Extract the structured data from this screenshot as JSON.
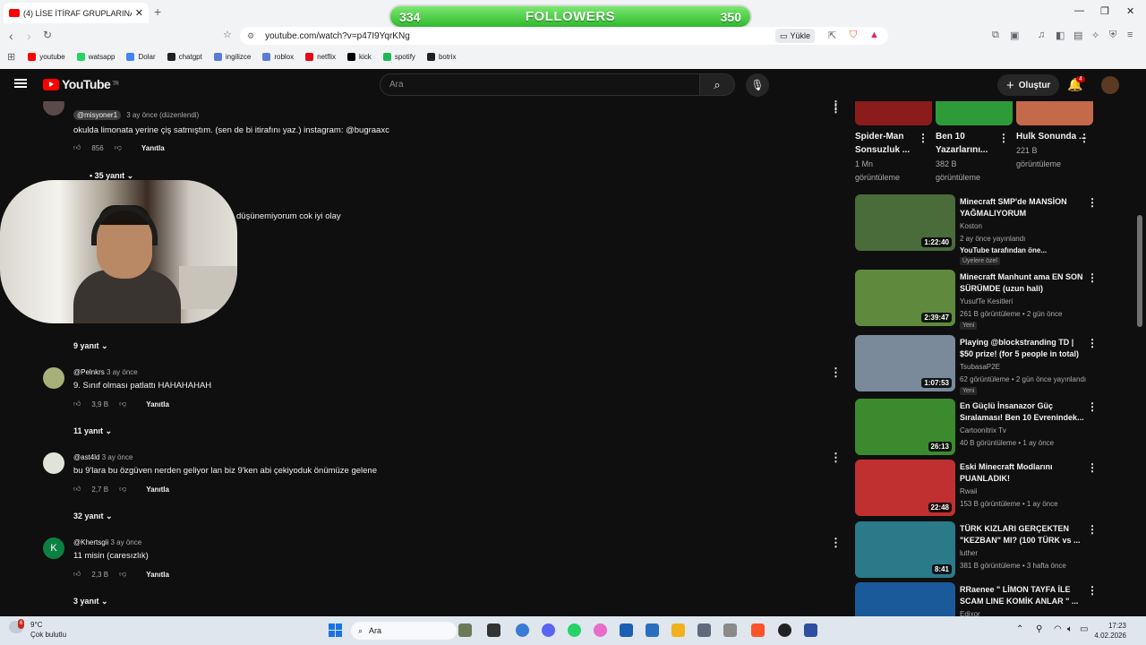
{
  "browser": {
    "tab_title": "(4) LİSE İTİRAF GRUPLARINA",
    "new_tab": "+",
    "url": "youtube.com/watch?v=p47I9YqrKNg",
    "yukle": "Yükle",
    "bookmarks": [
      {
        "label": "youtube",
        "color": "#ff0000"
      },
      {
        "label": "watsapp",
        "color": "#25d366"
      },
      {
        "label": "Dolar",
        "color": "#4285f4"
      },
      {
        "label": "chatgpt",
        "color": "#202124"
      },
      {
        "label": "ingilizce",
        "color": "#5b7bd5"
      },
      {
        "label": "roblox",
        "color": "#5b7bd5"
      },
      {
        "label": "netflix",
        "color": "#e50914"
      },
      {
        "label": "kick",
        "color": "#000000"
      },
      {
        "label": "spotify",
        "color": "#1db954"
      },
      {
        "label": "botrix",
        "color": "#202124"
      }
    ]
  },
  "overlay": {
    "left": "334",
    "title": "FOLLOWERS",
    "right": "350"
  },
  "youtube": {
    "logo": "YouTube",
    "logo_region": "TR",
    "search_placeholder": "Ara",
    "create_label": "Oluştur",
    "notif_count": "4"
  },
  "comments": {
    "first": {
      "tag": "@misyoner1",
      "meta": "3 ay önce (düzenlendi)",
      "text": "okulda limonata yerine çiş satmıştım. (sen de bi itirafını yaz.) instagram: @bugraaxc",
      "likes": "856",
      "reply": "Yanıtla"
    },
    "first_replies": "• 35 yanıt",
    "hidden_text": "düşünemiyorum cok iyi olay",
    "hidden_replies": "9 yanıt",
    "items": [
      {
        "author": "@Pelnkrs",
        "time": "3 ay önce",
        "text": "9. Sınıf olması patlattı HAHAHAHAH",
        "likes": "3,9 B",
        "reply": "Yanıtla",
        "replies": "11 yanıt",
        "avatar": "#a8b07a"
      },
      {
        "author": "@ast4ld",
        "time": "3 ay önce",
        "text": "bu 9'lara bu özgüven nerden geliyor lan biz 9'ken abi çekiyoduk önümüze gelene",
        "likes": "2,7 B",
        "reply": "Yanıtla",
        "replies": "32 yanıt",
        "avatar": "#e0e4d8"
      },
      {
        "author": "@Khertsgii",
        "time": "3 ay önce",
        "text": "11 misin (caresızlık)",
        "likes": "2,3 B",
        "reply": "Yanıtla",
        "replies": "3 yanıt",
        "avatar": "#0b8043",
        "initial": "K"
      }
    ]
  },
  "shorts": [
    {
      "title": "Spider-Man Sonsuzluk ...",
      "views": "1 Mn",
      "views_label": "görüntüleme",
      "color": "#8a1c1c"
    },
    {
      "title": "Ben 10 Yazarlarını...",
      "views": "382 B",
      "views_label": "görüntüleme",
      "color": "#2e9b3a"
    },
    {
      "title": "Hulk Sonunda ...",
      "views": "221 B",
      "views_label": "görüntüleme",
      "color": "#c46a4a"
    }
  ],
  "videos": [
    {
      "title": "Minecraft SMP'de MANSİON YAĞMALIYORUM",
      "channel": "Koston",
      "stats": "2 ay önce yayınlandı",
      "extra": "YouTube tarafından öne...",
      "tag": "Üyelere özel",
      "duration": "1:22:40",
      "color": "#4a6b3a"
    },
    {
      "title": "Minecraft Manhunt ama EN SON SÜRÜMDE (uzun hali)",
      "channel": "YusufTe Kesitleri",
      "stats": "261 B görüntüleme • 2 gün önce",
      "tag": "Yeni",
      "duration": "2:39:47",
      "color": "#5f8a3e"
    },
    {
      "title": "Playing @blockstranding TD | $50 prize! (for 5 people in total)",
      "channel": "TsubasaP2E",
      "stats": "62 görüntüleme • 2 gün önce yayınlandı",
      "tag": "Yeni",
      "duration": "1:07:53",
      "color": "#7a8a9a"
    },
    {
      "title": "En Güçlü İnsanazor Güç Sıralaması! Ben 10 Evrenindek...",
      "channel": "Cartoonitrix Tv",
      "stats": "40 B görüntüleme • 1 ay önce",
      "duration": "26:13",
      "color": "#3b8a2e"
    },
    {
      "title": "Eski Minecraft Modlarını PUANLADIK!",
      "channel": "Rwaii",
      "stats": "153 B görüntüleme • 1 ay önce",
      "duration": "22:48",
      "color": "#c03030"
    },
    {
      "title": "TÜRK KIZLARI GERÇEKTEN \"KEZBAN\" MI? (100 TÜRK vs ...",
      "channel": "luther",
      "stats": "381 B görüntüleme • 3 hafta önce",
      "duration": "8:41",
      "color": "#2a7a8a"
    },
    {
      "title": "RRaenee \" LİMON TAYFA İLE SCAM LINE KOMİK ANLAR \" ...",
      "channel": "Edixor",
      "stats": "",
      "color": "#1a5a9a"
    }
  ],
  "taskbar": {
    "weather_badge": "6",
    "temp": "9°C",
    "weather": "Çok bulutlu",
    "search": "Ara",
    "time": "17:23",
    "date": "4.02.2026"
  }
}
